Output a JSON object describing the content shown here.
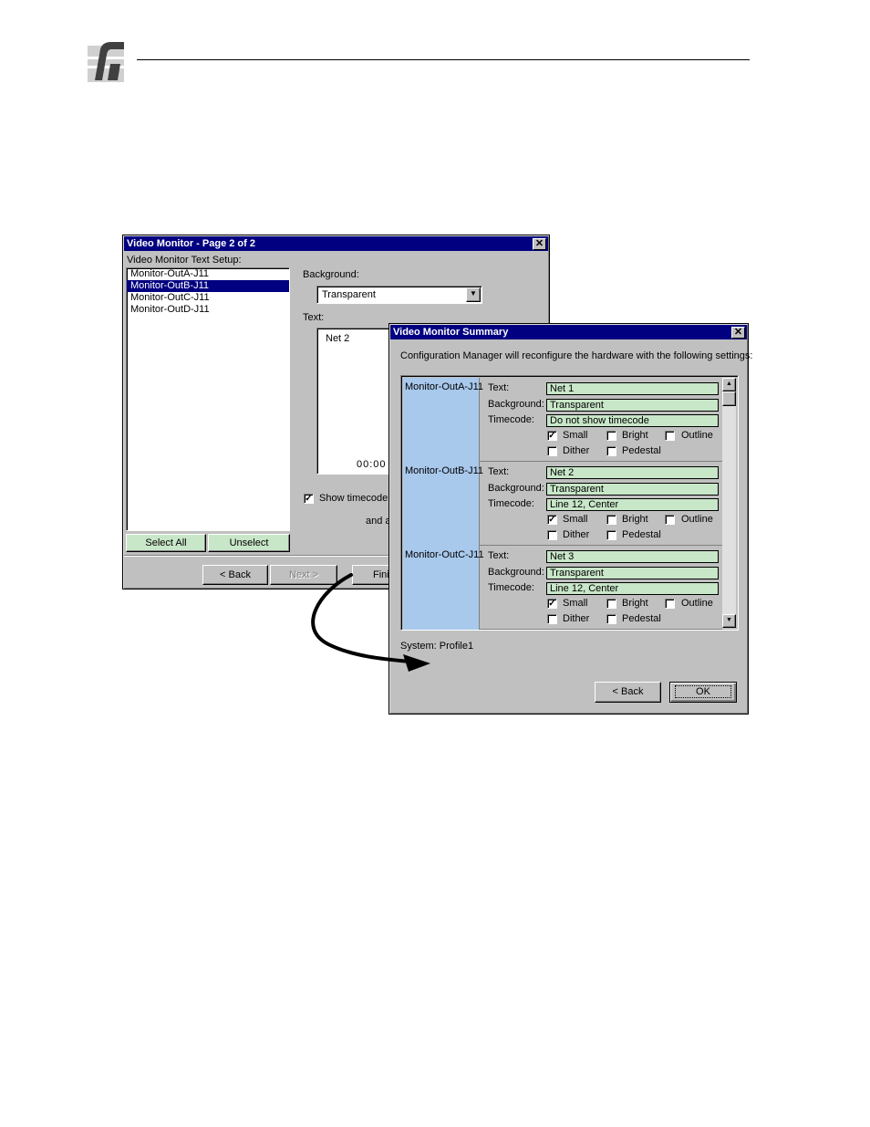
{
  "dialog1": {
    "title": "Video Monitor - Page 2 of 2",
    "setup_label": "Video Monitor Text Setup:",
    "monitors": [
      "Monitor-OutA-J11",
      "Monitor-OutB-J11",
      "Monitor-OutC-J11",
      "Monitor-OutD-J11"
    ],
    "selected_index": 1,
    "select_all": "Select All",
    "unselect": "Unselect",
    "background_label": "Background:",
    "background_value": "Transparent",
    "text_label": "Text:",
    "text_value": "Net 2",
    "timecode_preview": "00:00",
    "show_timecode": "Show timecode",
    "and_a": "and a",
    "back": "< Back",
    "next": "Next >",
    "finish": "Fini"
  },
  "dialog2": {
    "title": "Video Monitor Summary",
    "intro": "Configuration Manager will reconfigure the hardware with the following settings:",
    "labels": {
      "text": "Text:",
      "background": "Background:",
      "timecode": "Timecode:",
      "small": "Small",
      "bright": "Bright",
      "outline": "Outline",
      "dither": "Dither",
      "pedestal": "Pedestal"
    },
    "rows": [
      {
        "name": "Monitor-OutA-J11",
        "text": "Net 1",
        "background": "Transparent",
        "timecode": "Do not show timecode"
      },
      {
        "name": "Monitor-OutB-J11",
        "text": "Net 2",
        "background": "Transparent",
        "timecode": "Line 12, Center"
      },
      {
        "name": "Monitor-OutC-J11",
        "text": "Net 3",
        "background": "Transparent",
        "timecode": "Line 12, Center"
      }
    ],
    "system": "System:  Profile1",
    "back": "< Back",
    "ok": "OK"
  },
  "icons": [
    "company-logo-icon",
    "close-icon",
    "dropdown-arrow-icon",
    "scroll-up-icon",
    "scroll-down-icon",
    "arrow-icon"
  ],
  "colors": {
    "titlebar": "#000080",
    "field": "#c8e6c8",
    "monitor_cell": "#a8c8ec",
    "dialog": "#c0c0c0"
  }
}
